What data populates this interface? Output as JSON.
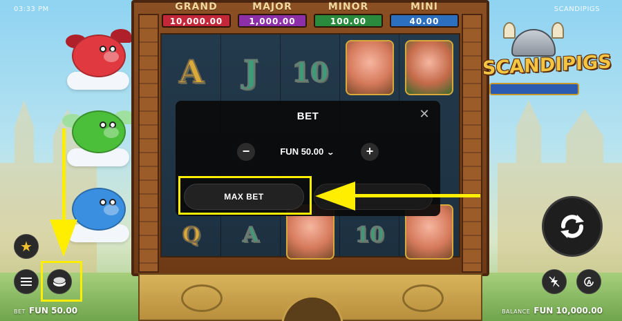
{
  "status_bar": {
    "time": "03:33 PM",
    "game_name": "SCANDIPIGS"
  },
  "jackpots": [
    {
      "name": "GRAND",
      "value": "10,000.00",
      "color": "#c2283a"
    },
    {
      "name": "MAJOR",
      "value": "1,000.00",
      "color": "#8c2fa8"
    },
    {
      "name": "MINOR",
      "value": "100.00",
      "color": "#2a8b3f"
    },
    {
      "name": "MINI",
      "value": "40.00",
      "color": "#2d6fbf"
    }
  ],
  "reels": {
    "symbols": [
      "A",
      "J",
      "10",
      "viking-girl-pig",
      "viking-pig",
      "Q",
      "A",
      "beer-pig",
      "10",
      "sheep-pig"
    ]
  },
  "logo": {
    "text": "SCANDIPIGS"
  },
  "bet_modal": {
    "title": "BET",
    "close_icon": "close-icon",
    "decrease_icon": "minus-icon",
    "increase_icon": "plus-icon",
    "bet_value": "FUN 50.00",
    "max_bet_label": "MAX BET"
  },
  "controls": {
    "favorite_icon": "star-icon",
    "menu_icon": "hamburger-menu-icon",
    "bet_icon": "coin-stack-icon",
    "spin_icon": "spin-arrows-icon",
    "turbo_icon": "lightning-off-icon",
    "autoplay_icon": "autoplay-icon"
  },
  "footer": {
    "bet_label": "BET",
    "bet_value": "FUN 50.00",
    "balance_label": "BALANCE",
    "balance_value": "FUN 10,000.00"
  },
  "annotation_color": "#ffee00"
}
